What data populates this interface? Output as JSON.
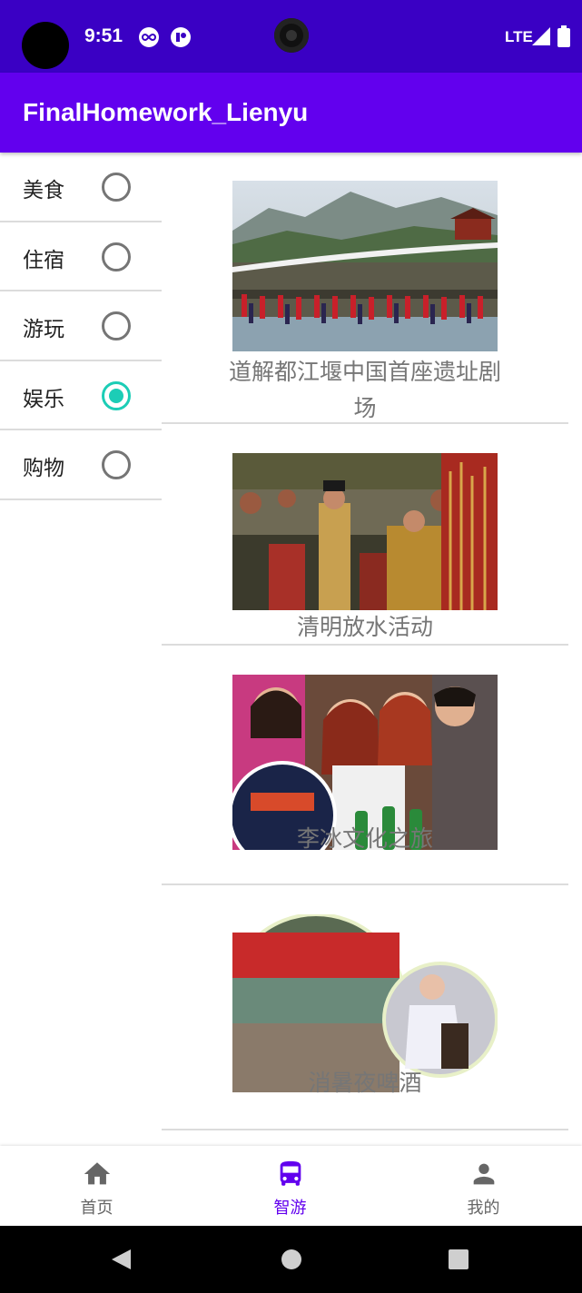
{
  "status_bar": {
    "time": "9:51",
    "network": "LTE",
    "icons": [
      "infinity-icon",
      "app-badge-icon",
      "signal-icon",
      "battery-icon"
    ]
  },
  "app_bar": {
    "title": "FinalHomework_Lienyu"
  },
  "sidebar": {
    "items": [
      {
        "label": "美食",
        "checked": false
      },
      {
        "label": "住宿",
        "checked": false
      },
      {
        "label": "游玩",
        "checked": false
      },
      {
        "label": "娱乐",
        "checked": true
      },
      {
        "label": "购物",
        "checked": false
      }
    ],
    "accent_color": "#1ccdb6"
  },
  "content": {
    "items": [
      {
        "title": "道解都江堰中国首座遗址剧场",
        "image": "performance-photo"
      },
      {
        "title": "清明放水活动",
        "image": "ceremony-photo"
      },
      {
        "title": "李冰文化之旅",
        "image": "friends-photo"
      },
      {
        "title": "消暑夜啤酒",
        "image": "riverside-photo"
      }
    ]
  },
  "bottom_nav": {
    "items": [
      {
        "label": "首页",
        "icon": "home-icon",
        "active": false
      },
      {
        "label": "智游",
        "icon": "bus-icon",
        "active": true
      },
      {
        "label": "我的",
        "icon": "person-icon",
        "active": false
      }
    ],
    "active_color": "#6200ee"
  },
  "colors": {
    "status_bar": "#3a00c4",
    "app_bar": "#6200ee"
  }
}
